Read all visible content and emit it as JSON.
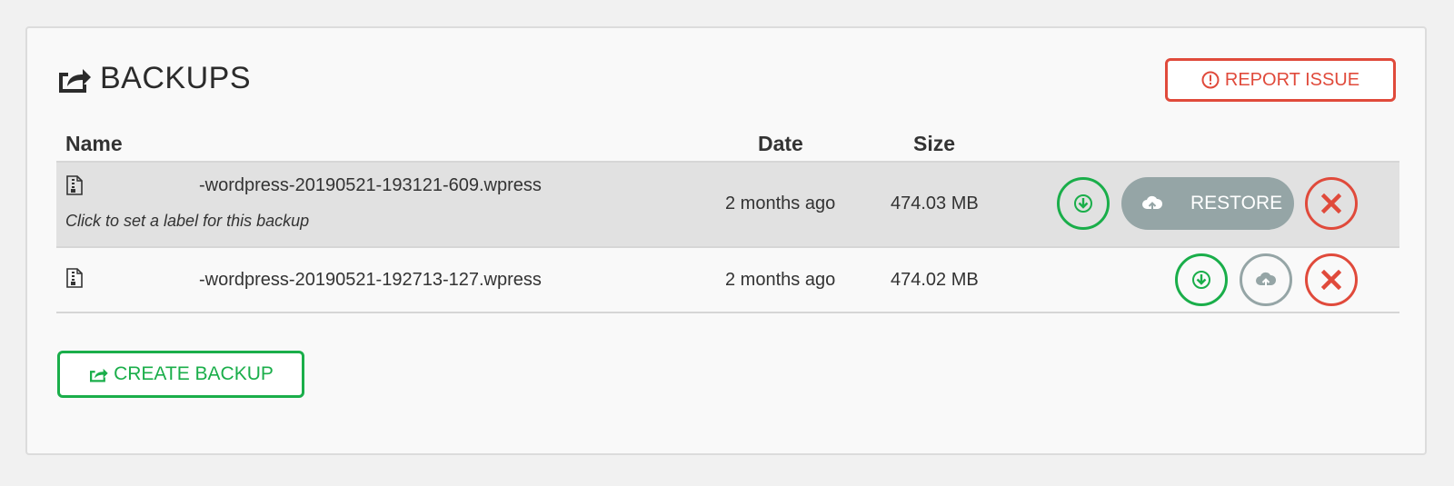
{
  "header": {
    "title": "BACKUPS",
    "title_icon": "share-export-icon",
    "report_button": {
      "label": "REPORT ISSUE",
      "icon": "exclamation-circle-icon",
      "color": "#e04a3b"
    }
  },
  "table": {
    "columns": [
      "Name",
      "Date",
      "Size"
    ],
    "rows": [
      {
        "icon": "archive-file-icon",
        "name": "-wordpress-20190521-193121-609.wpress",
        "label_hint": "Click to set a label for this backup",
        "date": "2 months ago",
        "size": "474.03 MB",
        "hovered": true,
        "actions": {
          "download_icon": "download-circle-icon",
          "restore_label": "RESTORE",
          "restore_icon": "cloud-upload-icon",
          "delete_icon": "close-x-icon"
        }
      },
      {
        "icon": "archive-file-icon",
        "name": "-wordpress-20190521-192713-127.wpress",
        "date": "2 months ago",
        "size": "474.02 MB",
        "hovered": false,
        "actions": {
          "download_icon": "download-circle-icon",
          "restore_icon": "cloud-upload-icon",
          "delete_icon": "close-x-icon"
        }
      }
    ]
  },
  "create_button": {
    "label": "CREATE BACKUP",
    "icon": "share-export-icon",
    "color": "#1aae4a"
  },
  "colors": {
    "green": "#1aae4a",
    "red": "#e04a3b",
    "grey": "#95a5a6",
    "row_hover": "#e1e1e1"
  }
}
